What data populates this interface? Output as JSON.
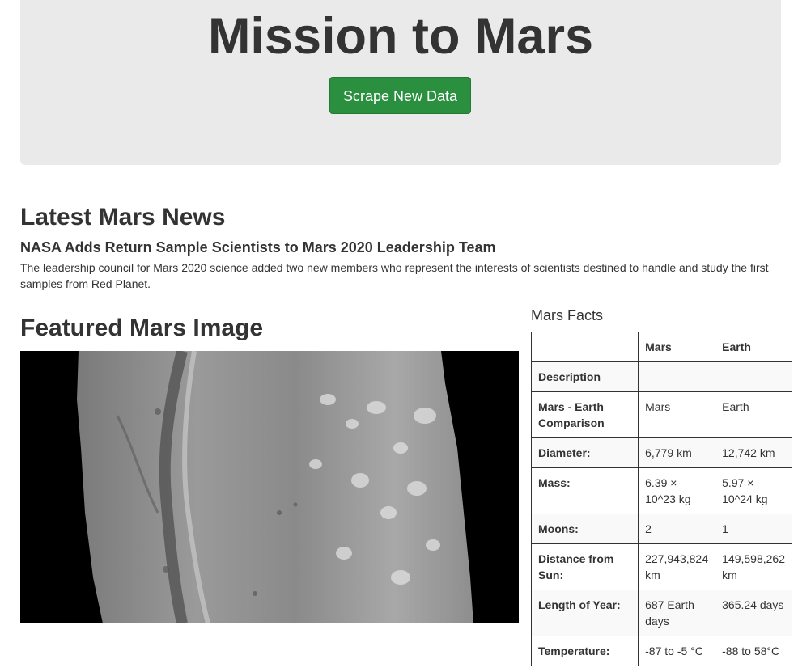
{
  "jumbotron": {
    "title": "Mission to Mars",
    "scrape_button": "Scrape New Data"
  },
  "news": {
    "heading": "Latest Mars News",
    "title": "NASA Adds Return Sample Scientists to Mars 2020 Leadership Team",
    "paragraph": "The leadership council for Mars 2020 science added two new members who represent the interests of scientists destined to handle and study the first samples from Red Planet."
  },
  "featured": {
    "heading": "Featured Mars Image"
  },
  "facts": {
    "heading": "Mars Facts",
    "columns": [
      "",
      "Mars",
      "Earth"
    ],
    "rows": [
      {
        "key": "Description",
        "mars": "",
        "earth": ""
      },
      {
        "key": "Mars - Earth Comparison",
        "mars": "Mars",
        "earth": "Earth"
      },
      {
        "key": "Diameter:",
        "mars": "6,779 km",
        "earth": "12,742 km"
      },
      {
        "key": "Mass:",
        "mars": "6.39 × 10^23 kg",
        "earth": "5.97 × 10^24 kg"
      },
      {
        "key": "Moons:",
        "mars": "2",
        "earth": "1"
      },
      {
        "key": "Distance from Sun:",
        "mars": "227,943,824 km",
        "earth": "149,598,262 km"
      },
      {
        "key": "Length of Year:",
        "mars": "687 Earth days",
        "earth": "365.24 days"
      },
      {
        "key": "Temperature:",
        "mars": "-87 to -5 °C",
        "earth": "-88 to 58°C"
      }
    ]
  },
  "colors": {
    "jumbotron_bg": "#eaeaea",
    "button_green": "#2a8f3e",
    "text": "#333333"
  }
}
